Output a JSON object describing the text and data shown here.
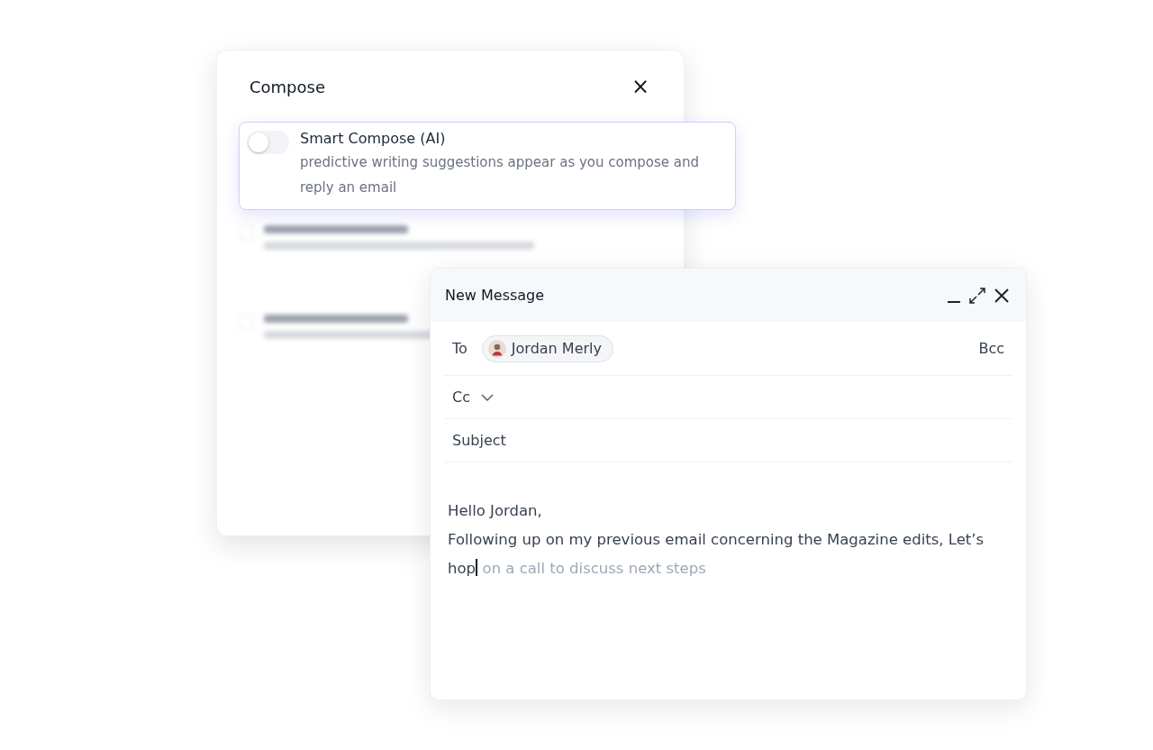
{
  "settings_panel": {
    "title": "Compose",
    "close": "×",
    "smart_compose": {
      "on": false,
      "title": "Smart Compose (AI)",
      "description": "predictive writing suggestions appear as you compose and reply an email"
    }
  },
  "message_window": {
    "title": "New Message",
    "to": {
      "label": "To",
      "recipients": [
        {
          "name": "Jordan Merly"
        }
      ],
      "bcc": "Bcc"
    },
    "cc": {
      "label": "Cc"
    },
    "subject": {
      "placeholder": "Subject"
    },
    "body": {
      "greeting": "Hello Jordan,",
      "typed_lines": [
        "Following up on my previous email concerning the Magazine edits, Let’s",
        "hop"
      ],
      "suggestion": "on a call to discuss next steps"
    }
  }
}
